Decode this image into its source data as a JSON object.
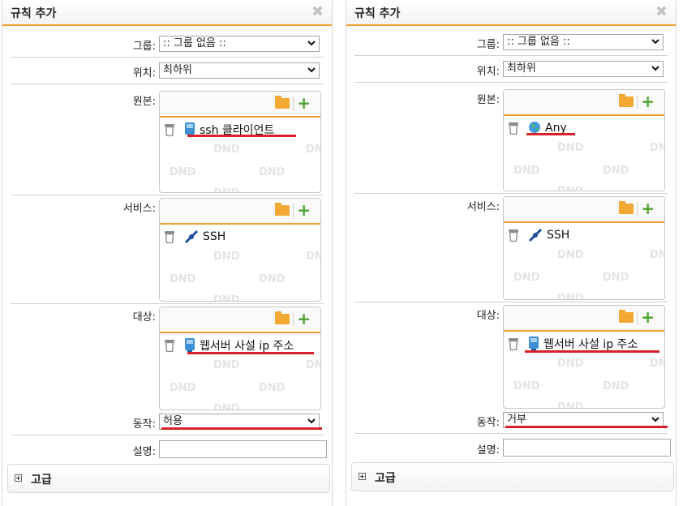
{
  "panels": [
    {
      "title": "규칙 추가",
      "group": {
        "label": "그룹:",
        "value": ":: 그룹 없음 ::"
      },
      "position": {
        "label": "위치:",
        "value": "최하위"
      },
      "source": {
        "label": "원본:",
        "entry": "ssh 클라이언트",
        "entry_icon": "host-icon"
      },
      "service": {
        "label": "서비스:",
        "entry": "SSH",
        "entry_icon": "service-plug-icon"
      },
      "destination": {
        "label": "대상:",
        "entry": "웹서버 사설 ip 주소",
        "entry_icon": "host-icon"
      },
      "action": {
        "label": "동작:",
        "value": "허용"
      },
      "description": {
        "label": "설명:",
        "value": ""
      },
      "advanced": {
        "label": "고급"
      }
    },
    {
      "title": "규칙 추가",
      "group": {
        "label": "그룹:",
        "value": ":: 그룹 없음 ::"
      },
      "position": {
        "label": "위치:",
        "value": "최하위"
      },
      "source": {
        "label": "원본:",
        "entry": "Any",
        "entry_icon": "globe-icon"
      },
      "service": {
        "label": "서비스:",
        "entry": "SSH",
        "entry_icon": "service-plug-icon"
      },
      "destination": {
        "label": "대상:",
        "entry": "웹서버 사설 ip 주소",
        "entry_icon": "host-icon"
      },
      "action": {
        "label": "동작:",
        "value": "거부"
      },
      "description": {
        "label": "설명:",
        "value": ""
      },
      "advanced": {
        "label": "고급"
      }
    }
  ],
  "dnd_text": "DND",
  "colors": {
    "accent": "#f0a030",
    "highlight": "#d9202b",
    "add": "#4aa32d"
  }
}
